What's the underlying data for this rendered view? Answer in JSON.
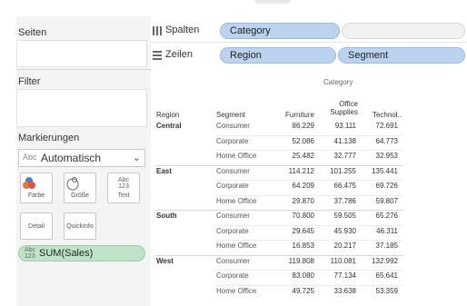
{
  "left_pane": {
    "pages_title": "Seiten",
    "filters_title": "Filter",
    "marks_title": "Markierungen",
    "marks_type_abc": "Abc",
    "marks_type": "Automatisch",
    "buttons": {
      "color": "Farbe",
      "size": "Größe",
      "text": "Text",
      "text_icon_top": "Abc",
      "text_icon_bottom": "123",
      "detail": "Detail",
      "tooltip": "QuickInfo"
    },
    "sales_pill_abc": "Abc",
    "sales_pill_123": "123",
    "sales_pill": "SUM(Sales)"
  },
  "shelves": {
    "columns_label": "Spalten",
    "columns_pill": "Category",
    "rows_label": "Zeilen",
    "rows_pill_1": "Region",
    "rows_pill_2": "Segment"
  },
  "table": {
    "category_header": "Category",
    "region_header": "Region",
    "segment_header": "Segment",
    "col_furniture": "Furniture",
    "col_office_line1": "Office",
    "col_office_line2": "Supplies",
    "col_technology": "Technol..",
    "regions": [
      {
        "name": "Central",
        "rows": [
          {
            "segment": "Consumer",
            "furniture": "86.229",
            "office": "93.111",
            "technology": "72.691"
          },
          {
            "segment": "Corporate",
            "furniture": "52.086",
            "office": "41.138",
            "technology": "64.773"
          },
          {
            "segment": "Home Office",
            "furniture": "25.482",
            "office": "32.777",
            "technology": "32.953"
          }
        ]
      },
      {
        "name": "East",
        "rows": [
          {
            "segment": "Consumer",
            "furniture": "114.212",
            "office": "101.255",
            "technology": "135.441"
          },
          {
            "segment": "Corporate",
            "furniture": "64.209",
            "office": "66.475",
            "technology": "69.726"
          },
          {
            "segment": "Home Office",
            "furniture": "29.870",
            "office": "37.786",
            "technology": "59.807"
          }
        ]
      },
      {
        "name": "South",
        "rows": [
          {
            "segment": "Consumer",
            "furniture": "70.800",
            "office": "59.505",
            "technology": "65.276"
          },
          {
            "segment": "Corporate",
            "furniture": "29.645",
            "office": "45.930",
            "technology": "46.311"
          },
          {
            "segment": "Home Office",
            "furniture": "16.853",
            "office": "20.217",
            "technology": "37.185"
          }
        ]
      },
      {
        "name": "West",
        "rows": [
          {
            "segment": "Consumer",
            "furniture": "119.808",
            "office": "110.081",
            "technology": "132.992"
          },
          {
            "segment": "Corporate",
            "furniture": "83.080",
            "office": "77.134",
            "technology": "65.641"
          },
          {
            "segment": "Home Office",
            "furniture": "49.725",
            "office": "33.638",
            "technology": "53.359"
          }
        ]
      }
    ]
  },
  "colors": {
    "dimension_pill": "#bcd3ef",
    "measure_pill": "#bfe3c7",
    "pane_bg": "#f4f4f4"
  },
  "icons": [
    "columns-shelf-icon",
    "rows-shelf-icon",
    "color-icon",
    "size-icon",
    "text-icon",
    "dropdown-chevron-icon"
  ]
}
